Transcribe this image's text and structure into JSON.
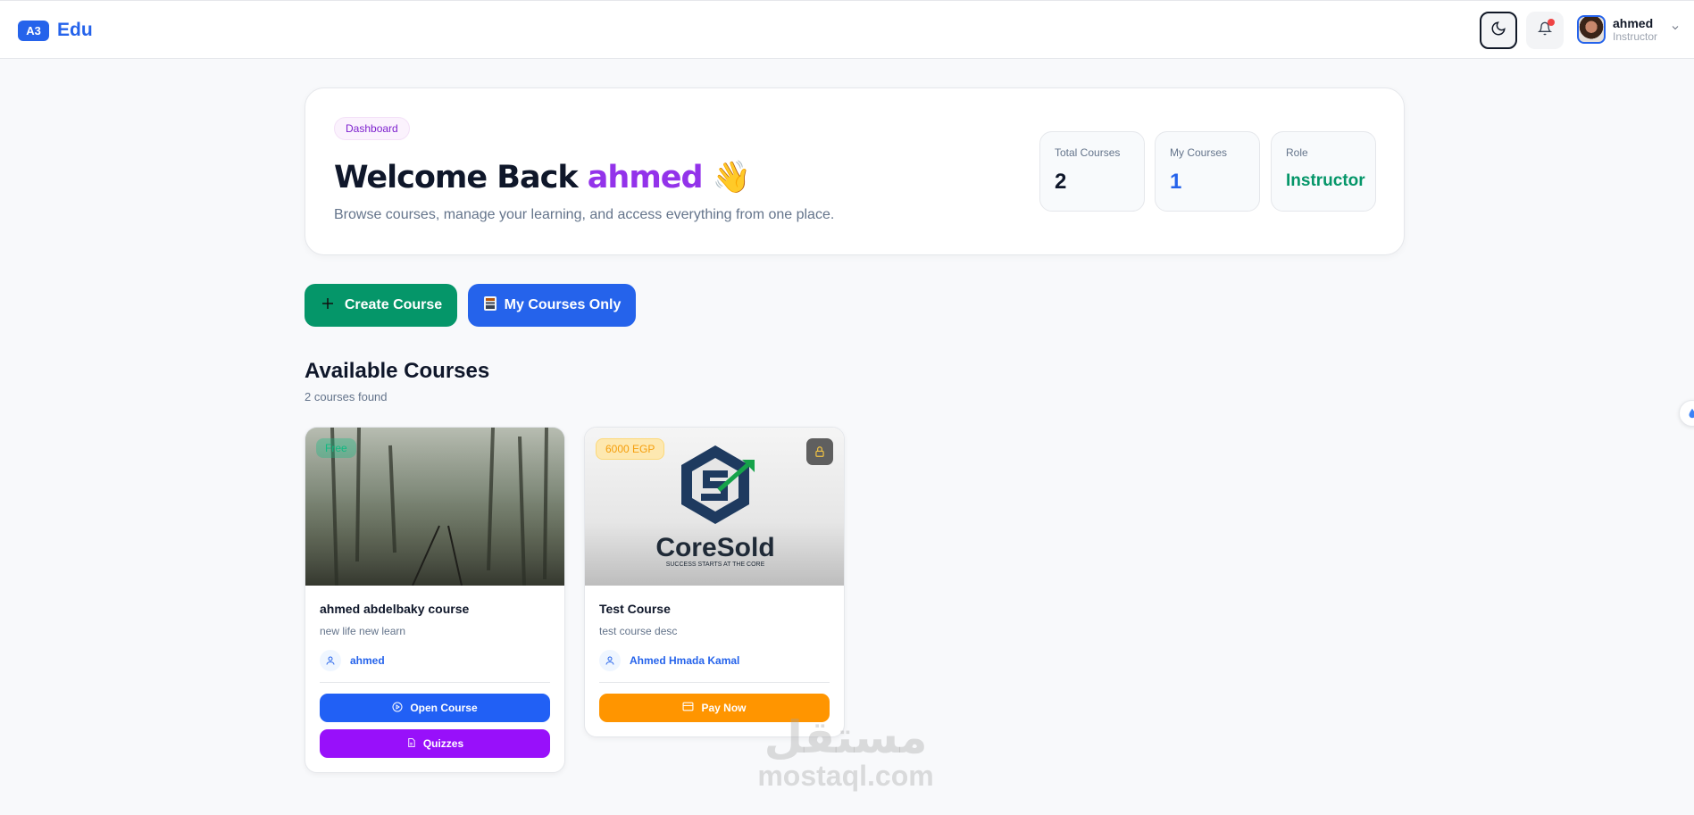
{
  "header": {
    "logo_badge": "A3",
    "logo_text": "Edu",
    "user": {
      "name": "ahmed",
      "role": "Instructor"
    },
    "icons": {
      "theme": "moon-icon",
      "notifications": "bell-icon",
      "dropdown": "chevron-down-icon"
    },
    "notification_dot_color": "#ef4444"
  },
  "welcome": {
    "pill": "Dashboard",
    "title_prefix": "Welcome Back",
    "title_name": "ahmed",
    "emoji": "👋",
    "subtitle": "Browse courses, manage your learning, and access everything from one place.",
    "stats": [
      {
        "label": "Total Courses",
        "value": "2",
        "color": "#0f172a"
      },
      {
        "label": "My Courses",
        "value": "1",
        "color": "#2563eb"
      },
      {
        "label": "Role",
        "value": "Instructor",
        "color": "#059669"
      }
    ]
  },
  "actions": {
    "create": "Create Course",
    "mine": "My Courses Only"
  },
  "courses_section": {
    "title": "Available Courses",
    "subtitle": "2 courses found"
  },
  "courses": [
    {
      "price": "Free",
      "title": "ahmed abdelbaky course",
      "description": "new life new learn",
      "instructor": "ahmed",
      "buttons": [
        "Open Course",
        "Quizzes"
      ],
      "image": "forest-railway"
    },
    {
      "price": "6000 EGP",
      "title": "Test Course",
      "description": "test course desc",
      "instructor": "Ahmed Hmada Kamal",
      "buttons": [
        "Pay Now"
      ],
      "image": "coresold-logo",
      "logo_text": "CoreSold",
      "logo_tagline": "SUCCESS STARTS AT THE CORE"
    }
  ],
  "watermark": {
    "arabic": "مستقل",
    "latin": "mostaql.com"
  },
  "colors": {
    "primary": "#2563eb",
    "success": "#059669",
    "purple": "#9333ea",
    "orange": "#f59e0b"
  }
}
